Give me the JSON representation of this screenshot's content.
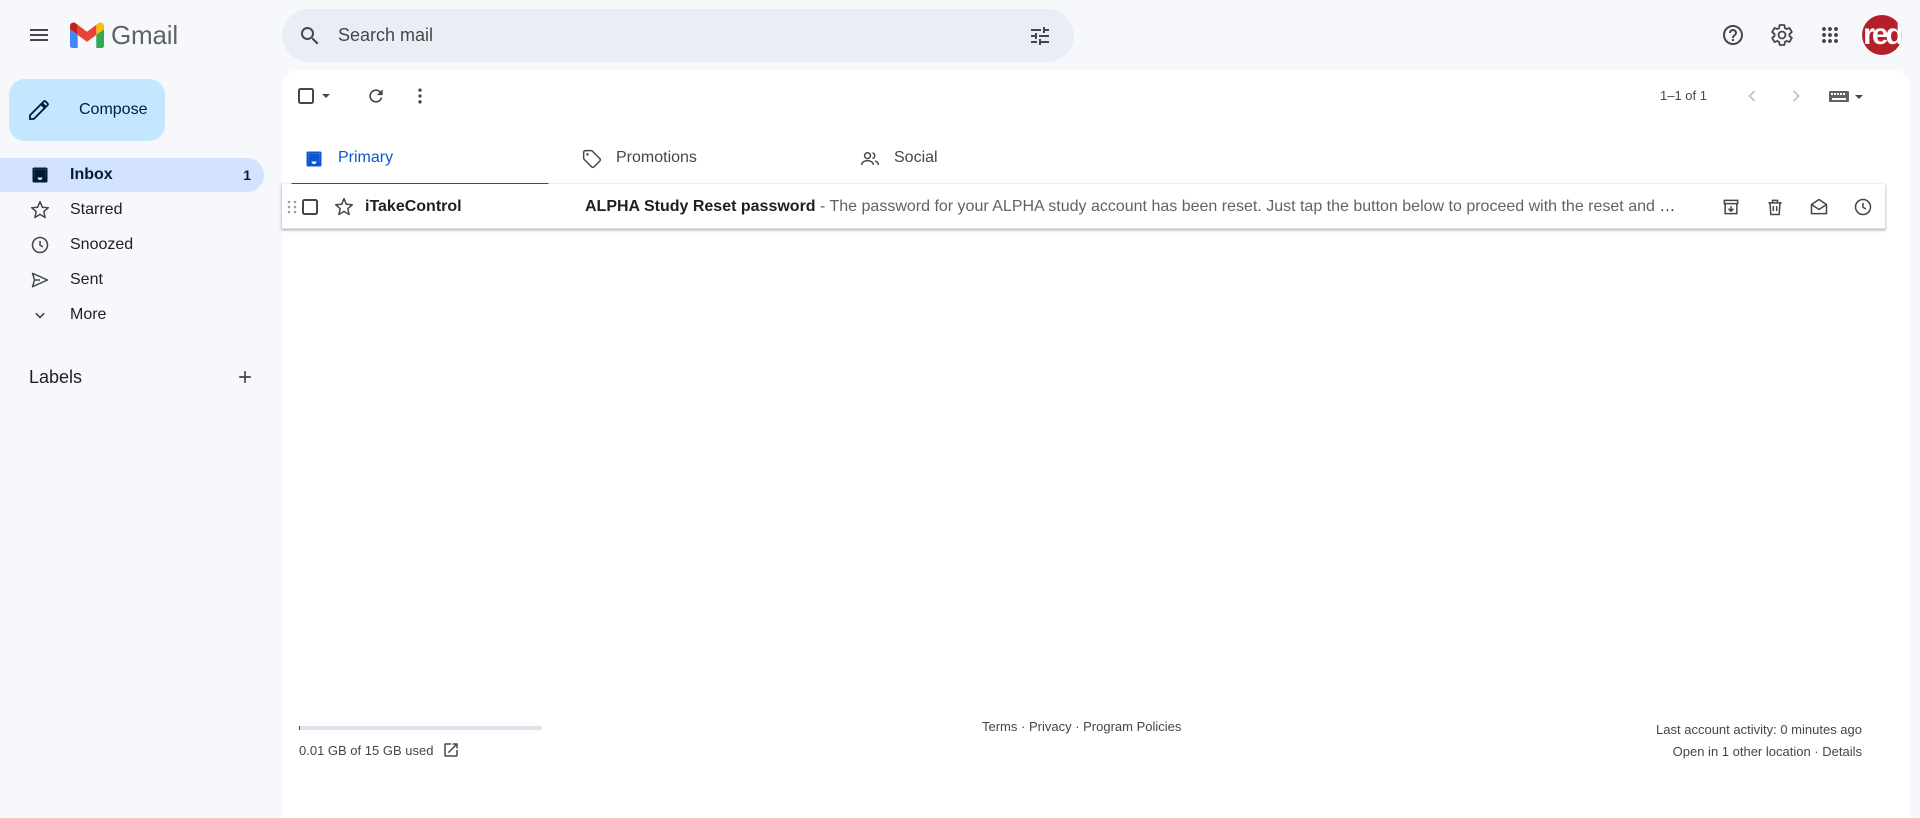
{
  "app": {
    "name": "Gmail"
  },
  "search": {
    "placeholder": "Search mail"
  },
  "avatar": {
    "text": "red"
  },
  "compose": {
    "label": "Compose"
  },
  "sidebar": {
    "items": [
      {
        "label": "Inbox",
        "count": "1",
        "icon": "inbox-icon"
      },
      {
        "label": "Starred",
        "icon": "star-icon"
      },
      {
        "label": "Snoozed",
        "icon": "clock-icon"
      },
      {
        "label": "Sent",
        "icon": "send-icon"
      },
      {
        "label": "More",
        "icon": "chevron-down-icon"
      }
    ],
    "labels_title": "Labels"
  },
  "toolbar": {
    "pager": "1–1 of 1"
  },
  "tabs": [
    {
      "label": "Primary"
    },
    {
      "label": "Promotions"
    },
    {
      "label": "Social"
    }
  ],
  "emails": [
    {
      "sender": "iTakeControl",
      "subject": "ALPHA Study Reset password",
      "separator": " - ",
      "snippet": "The password for your ALPHA study account has been reset. Just tap the button below to proceed with the reset and create a new password."
    }
  ],
  "footer": {
    "storage": "0.01 GB of 15 GB used",
    "storage_used_fraction": 0.0007,
    "links": [
      "Terms",
      "Privacy",
      "Program Policies"
    ],
    "link_separator": " · ",
    "last_activity": "Last account activity: 0 minutes ago",
    "open_in": "Open in 1 other location",
    "details": "Details"
  },
  "colors": {
    "background": "#f6f8fc",
    "compose": "#c2e7ff",
    "active_nav": "#d3e3fd",
    "accent": "#0b57d0",
    "avatar": "#b3202a"
  }
}
